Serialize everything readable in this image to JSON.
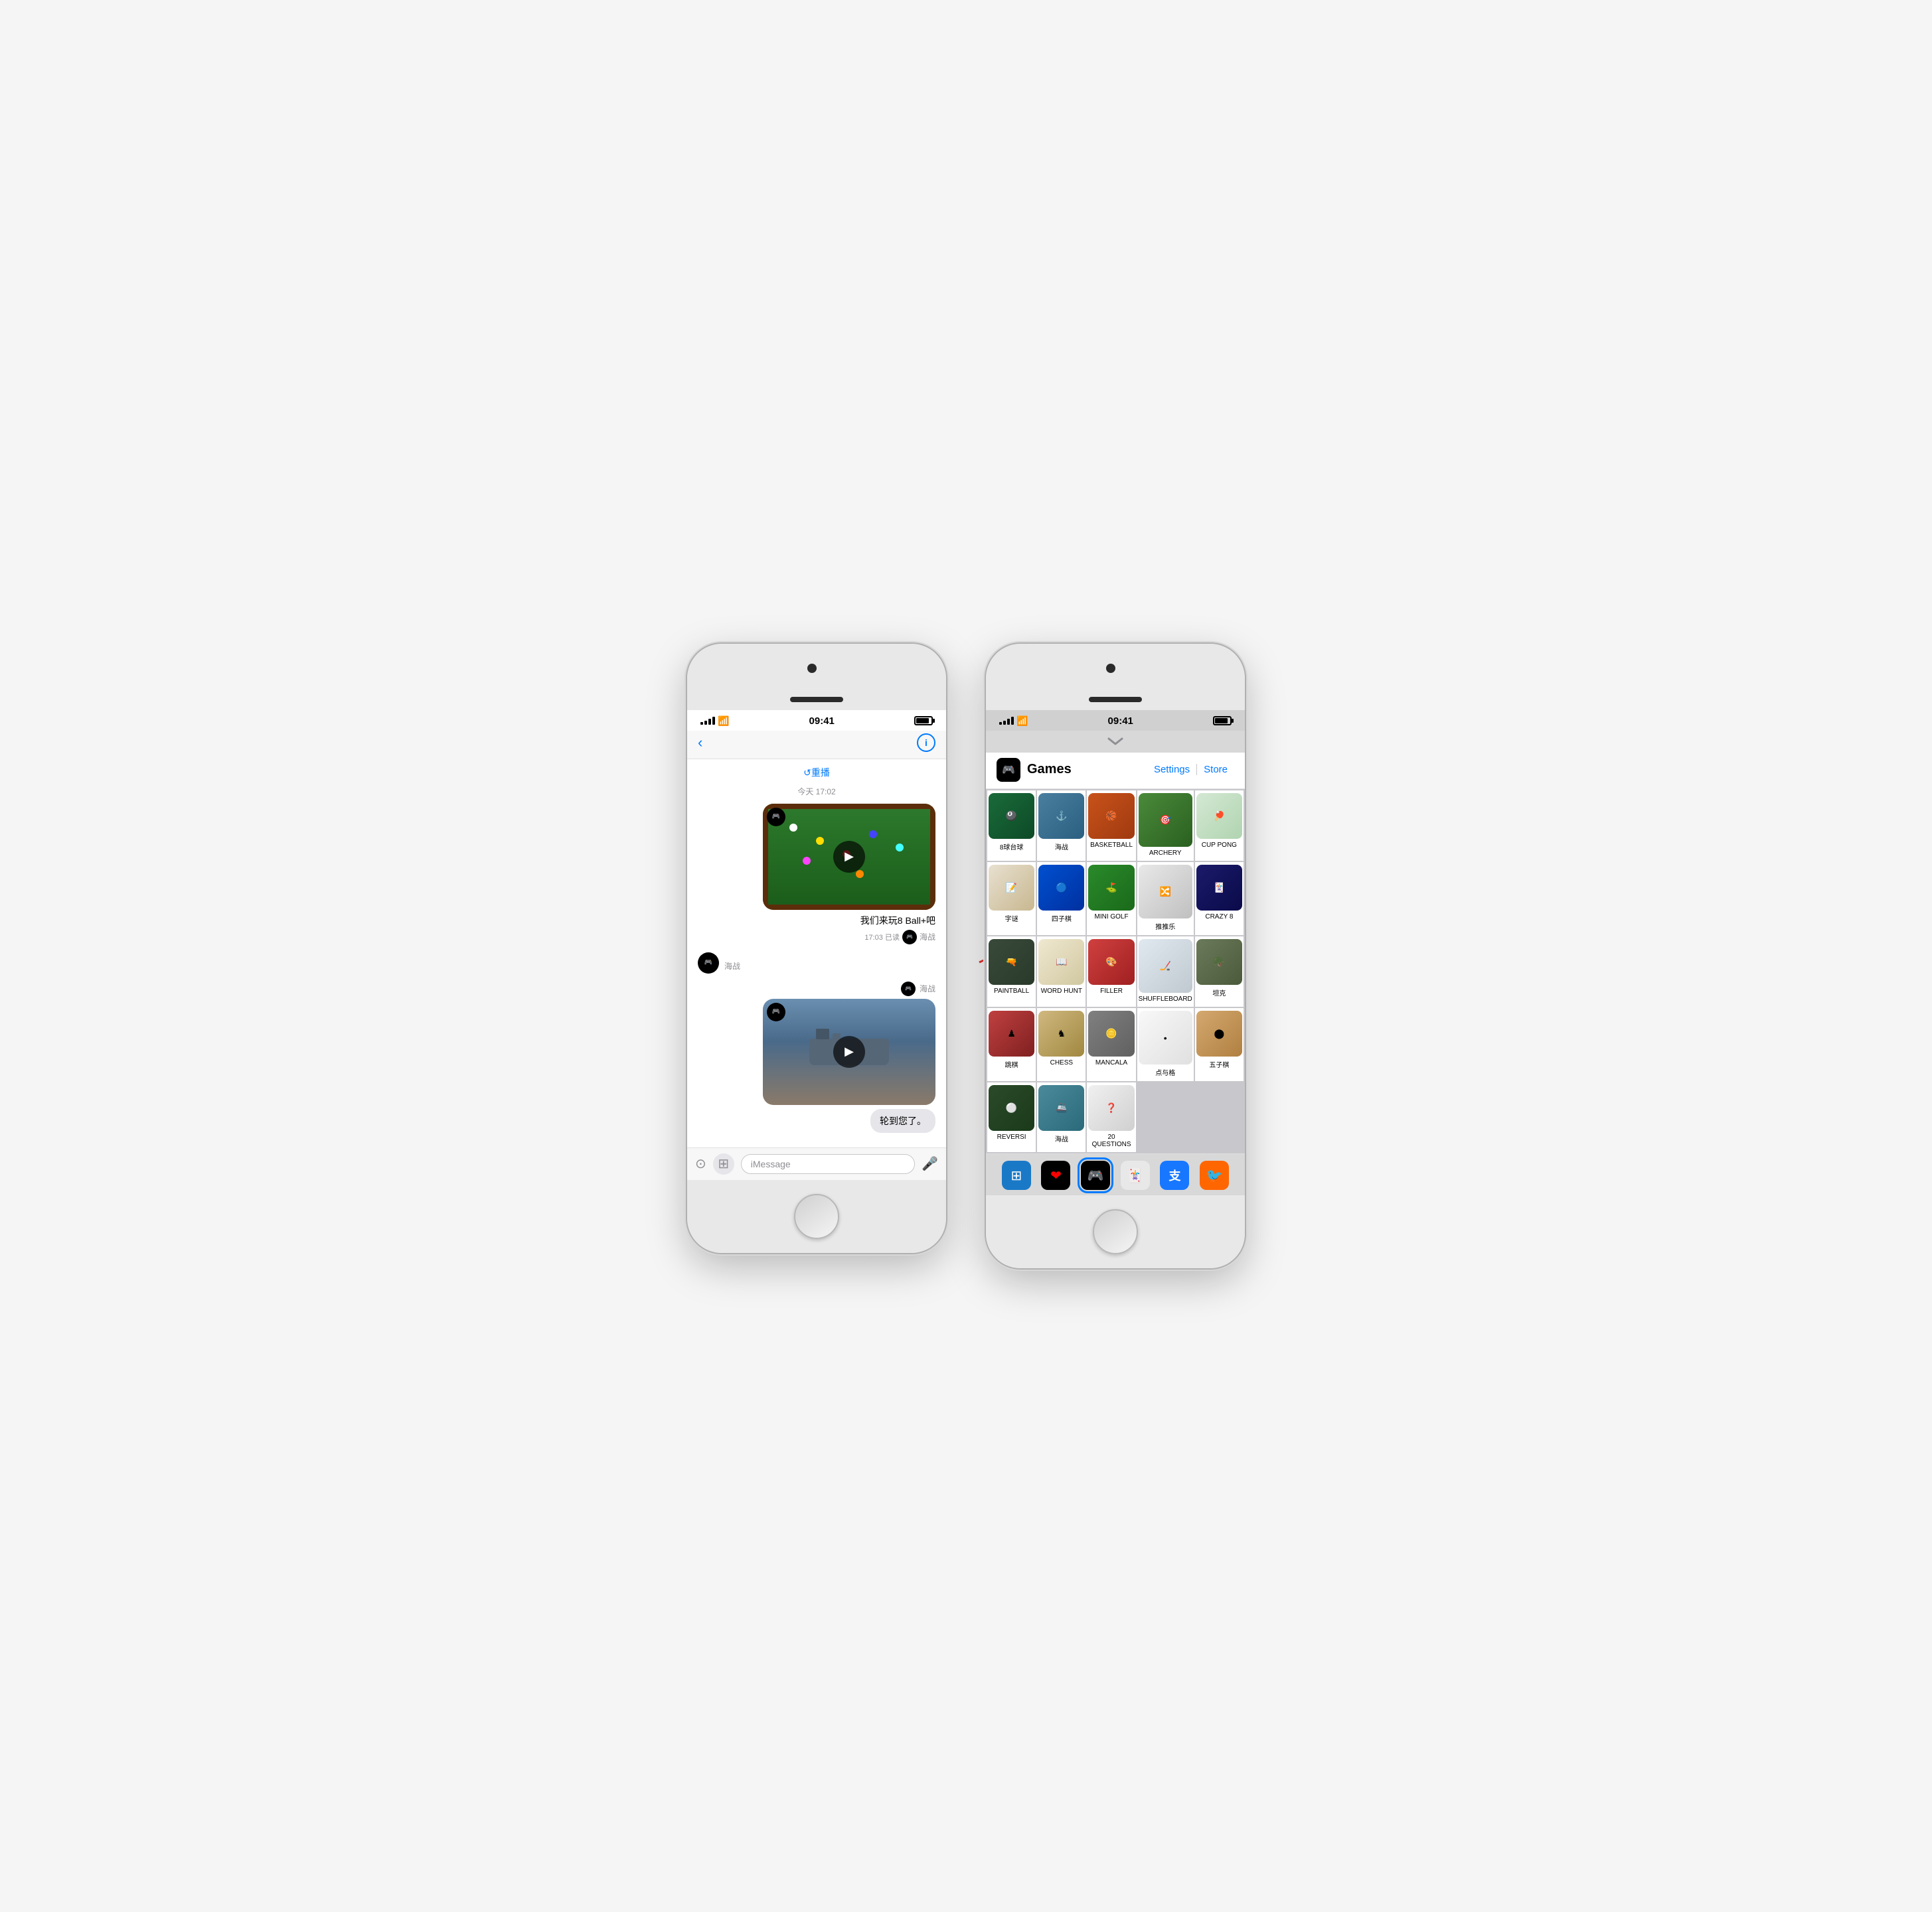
{
  "scene": {
    "title": "iPhone Messages and Games"
  },
  "phone1": {
    "status": {
      "time": "09:41",
      "signal": 4,
      "wifi": true,
      "battery": 85
    },
    "nav": {
      "back_label": "‹",
      "info_label": "i"
    },
    "messages": {
      "replay_label": "↺重播",
      "timestamp": "今天 17:02",
      "game1_label": "我们来玩8 Ball+吧",
      "read_status": "17:03 已读",
      "read_name": "海战",
      "msg_left_name": "海战",
      "msg_right_name": "海战",
      "turn_text": "轮到您了。",
      "input_placeholder": "iMessage"
    }
  },
  "phone2": {
    "status": {
      "time": "09:41",
      "signal": 4,
      "wifi": true,
      "battery": 85
    },
    "panel": {
      "chevron": "˅",
      "title": "Games",
      "settings_label": "Settings",
      "store_label": "Store"
    },
    "games": [
      {
        "name": "8球台球",
        "color": "billiards"
      },
      {
        "name": "海战",
        "color": "battleship"
      },
      {
        "name": "BASKETBALL",
        "color": "basketball"
      },
      {
        "name": "ARCHERY",
        "color": "archery"
      },
      {
        "name": "CUP PONG",
        "color": "cuppong"
      },
      {
        "name": "字谜",
        "color": "word"
      },
      {
        "name": "四子棋",
        "color": "connect4"
      },
      {
        "name": "MINI GOLF",
        "color": "minigolf"
      },
      {
        "name": "推推乐",
        "color": "pusher"
      },
      {
        "name": "CRAZY 8",
        "color": "crazy8"
      },
      {
        "name": "PAINTBALL",
        "color": "paintball"
      },
      {
        "name": "WORD HUNT",
        "color": "wordhunt"
      },
      {
        "name": "FILLER",
        "color": "filler"
      },
      {
        "name": "SHUFFLEBOARD",
        "color": "shuffleboard"
      },
      {
        "name": "坦克",
        "color": "tank"
      },
      {
        "name": "跳棋",
        "color": "checkers"
      },
      {
        "name": "CHESS",
        "color": "chess"
      },
      {
        "name": "MANCALA",
        "color": "mancala"
      },
      {
        "name": "点与格",
        "color": "dots"
      },
      {
        "name": "五子棋",
        "color": "gomoku"
      },
      {
        "name": "REVERSI",
        "color": "reversi"
      },
      {
        "name": "海战",
        "color": "billiards2"
      },
      {
        "name": "20 QUESTIONS",
        "color": "20q"
      }
    ],
    "dock": {
      "items": [
        "AppStore",
        "❤️",
        "🎮",
        "🃏",
        "支",
        "🐦"
      ]
    }
  }
}
